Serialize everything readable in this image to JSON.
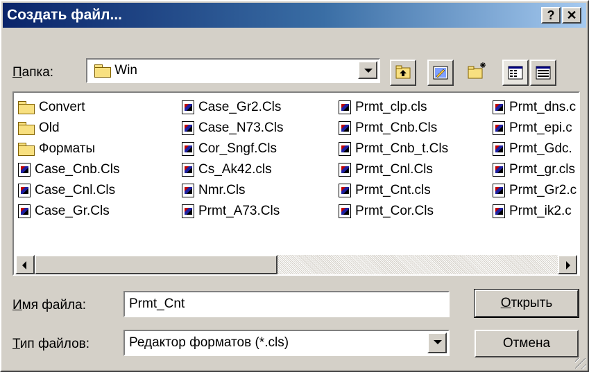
{
  "window": {
    "title": "Создать файл...",
    "help_label": "?",
    "close_label": "✕"
  },
  "folder_row": {
    "label_accel": "П",
    "label_rest": "апка:",
    "current_folder": "Win",
    "tools": [
      "up-one-level",
      "desktop",
      "create-new-folder",
      "list-view",
      "details-view"
    ]
  },
  "files": {
    "col1": [
      {
        "name": "Convert",
        "type": "folder"
      },
      {
        "name": "Old",
        "type": "folder"
      },
      {
        "name": "Форматы",
        "type": "folder"
      },
      {
        "name": "Case_Cnb.Cls",
        "type": "file"
      },
      {
        "name": "Case_Cnl.Cls",
        "type": "file"
      },
      {
        "name": "Case_Gr.Cls",
        "type": "file"
      }
    ],
    "col2": [
      {
        "name": "Case_Gr2.Cls",
        "type": "file"
      },
      {
        "name": "Case_N73.Cls",
        "type": "file"
      },
      {
        "name": "Cor_Sngf.Cls",
        "type": "file"
      },
      {
        "name": "Cs_Ak42.cls",
        "type": "file"
      },
      {
        "name": "Nmr.Cls",
        "type": "file"
      },
      {
        "name": "Prmt_A73.Cls",
        "type": "file"
      }
    ],
    "col3": [
      {
        "name": "Prmt_clp.cls",
        "type": "file"
      },
      {
        "name": "Prmt_Cnb.Cls",
        "type": "file"
      },
      {
        "name": "Prmt_Cnb_t.Cls",
        "type": "file"
      },
      {
        "name": "Prmt_Cnl.Cls",
        "type": "file"
      },
      {
        "name": "Prmt_Cnt.cls",
        "type": "file"
      },
      {
        "name": "Prmt_Cor.Cls",
        "type": "file"
      }
    ],
    "col4": [
      {
        "name": "Prmt_dns.c",
        "type": "file"
      },
      {
        "name": "Prmt_epi.c",
        "type": "file"
      },
      {
        "name": "Prmt_Gdc.",
        "type": "file"
      },
      {
        "name": "Prmt_gr.cls",
        "type": "file"
      },
      {
        "name": "Prmt_Gr2.c",
        "type": "file"
      },
      {
        "name": "Prmt_ik2.c",
        "type": "file"
      }
    ]
  },
  "filename_row": {
    "label_accel": "И",
    "label_rest": "мя файла:",
    "value": "Prmt_Cnt"
  },
  "filetype_row": {
    "label_accel": "Т",
    "label_rest": "ип файлов:",
    "value": "Редактор форматов (*.cls)"
  },
  "buttons": {
    "open_accel": "О",
    "open_rest": "ткрыть",
    "cancel": "Отмена"
  }
}
